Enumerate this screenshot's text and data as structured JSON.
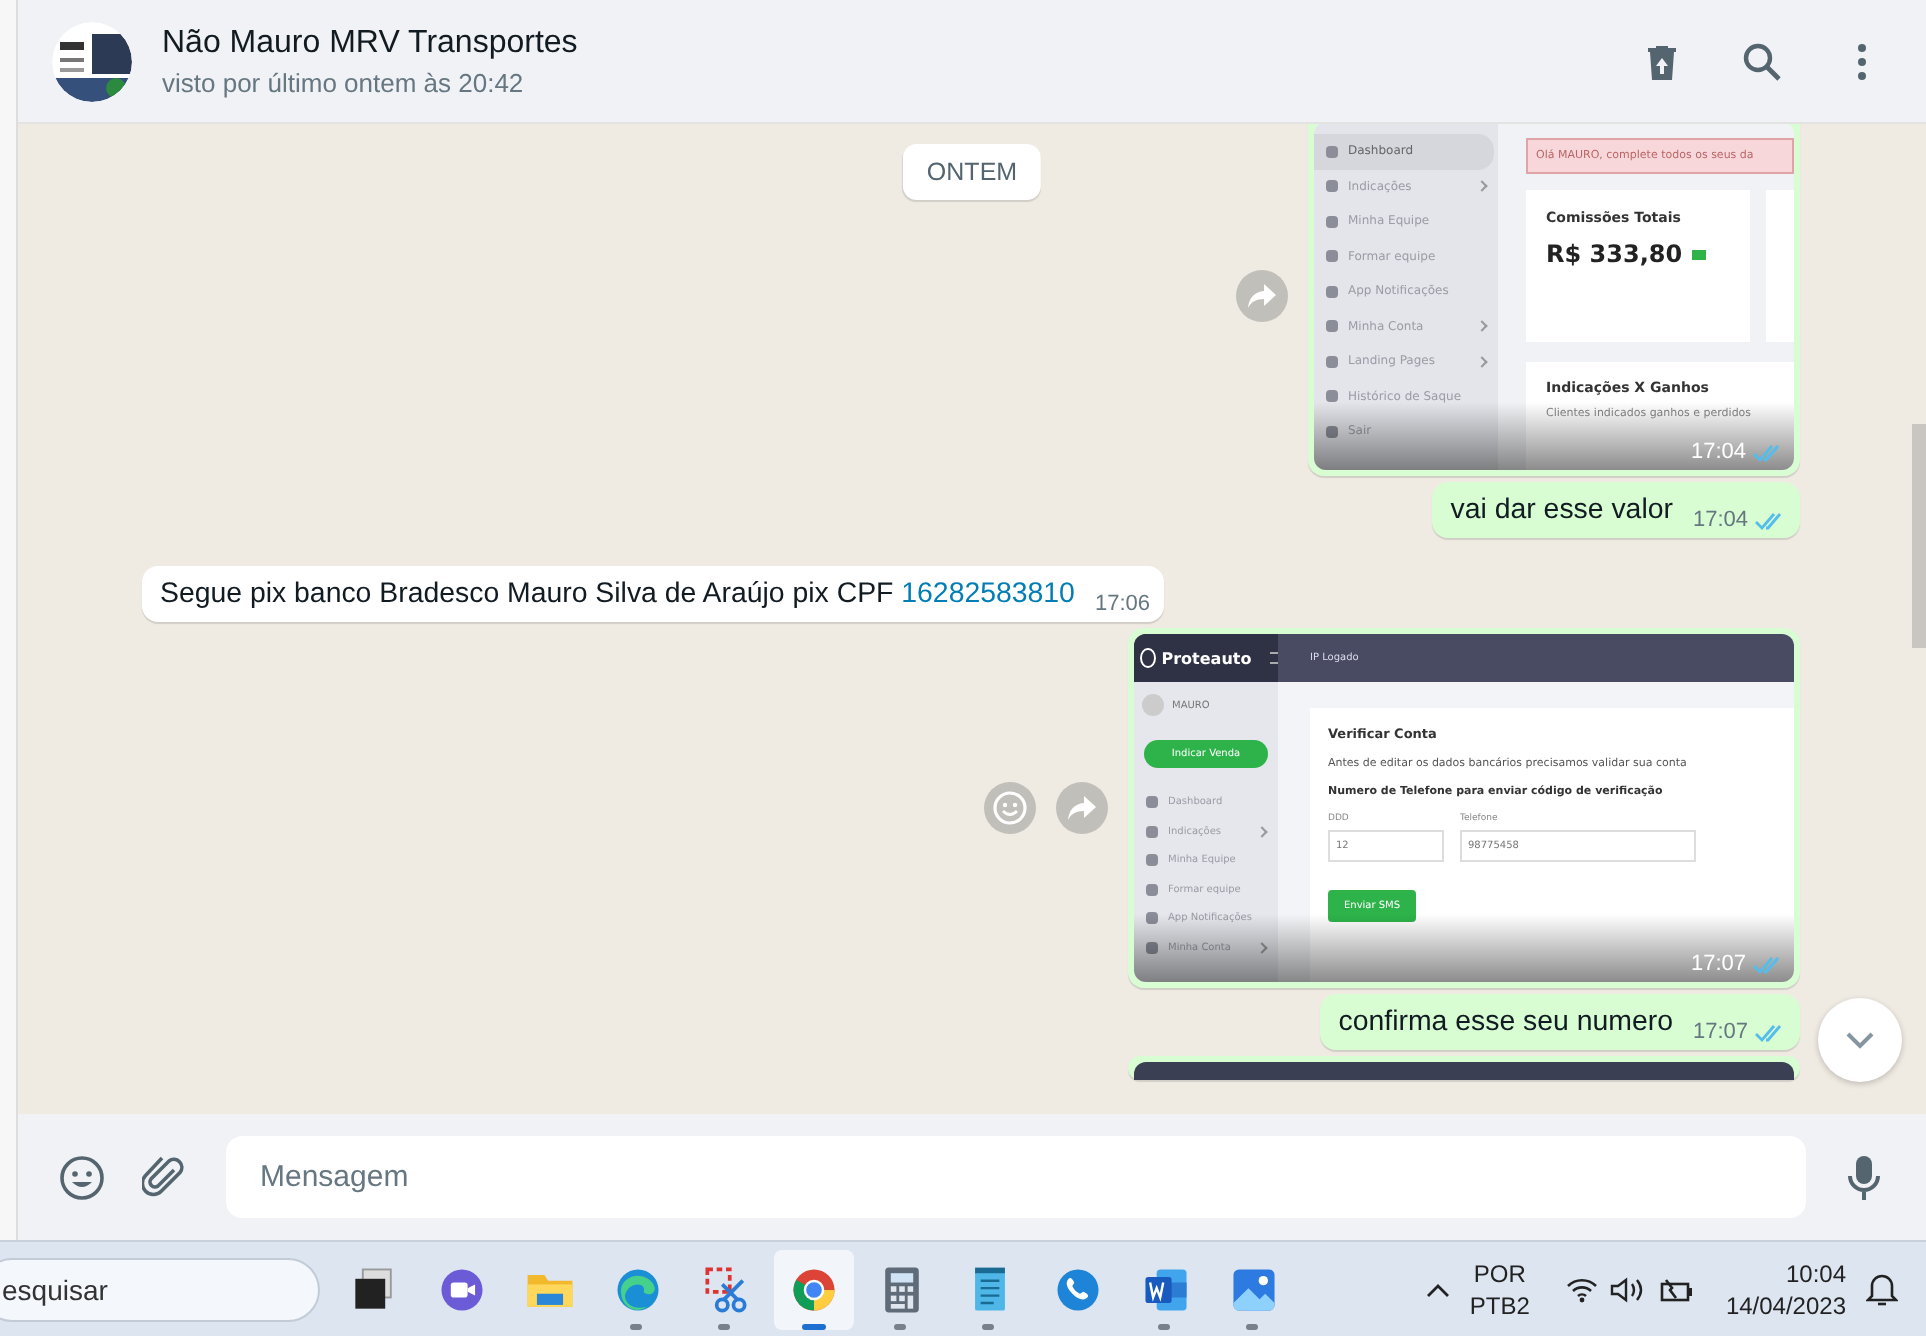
{
  "header": {
    "contact_name": "Não Mauro MRV Transportes",
    "last_seen": "visto por último ontem às 20:42"
  },
  "date_badge": "ONTEM",
  "messages": [
    {
      "kind": "image",
      "sent": true,
      "time": "17:04",
      "read": true,
      "forward_button": true,
      "screen": {
        "kind": "dashboard",
        "menu": [
          {
            "label": "Dashboard",
            "selected": true,
            "submenu": false
          },
          {
            "label": "Indicações",
            "selected": false,
            "submenu": true
          },
          {
            "label": "Minha Equipe",
            "selected": false,
            "submenu": false
          },
          {
            "label": "Formar equipe",
            "selected": false,
            "submenu": false
          },
          {
            "label": "App Notificações",
            "selected": false,
            "submenu": false
          },
          {
            "label": "Minha Conta",
            "selected": false,
            "submenu": true
          },
          {
            "label": "Landing Pages",
            "selected": false,
            "submenu": true
          },
          {
            "label": "Histórico de Saque",
            "selected": false,
            "submenu": false
          },
          {
            "label": "Sair",
            "selected": false,
            "submenu": false
          }
        ],
        "alert": "Olá MAURO, complete todos os seus da",
        "card_title": "Comissões Totais",
        "card_value": "R$ 333,80",
        "chart_title": "Indicações X Ganhos",
        "chart_subtitle": "Clientes indicados ganhos e perdidos"
      }
    },
    {
      "kind": "text",
      "sent": true,
      "text": "vai dar esse valor",
      "time": "17:04",
      "read": true
    },
    {
      "kind": "text",
      "sent": false,
      "text": "Segue pix banco Bradesco Mauro Silva de Araújo pix CPF",
      "link": "16282583810",
      "time": "17:06"
    },
    {
      "kind": "image",
      "sent": true,
      "time": "17:07",
      "read": true,
      "forward_button": true,
      "emoji_button": true,
      "screen": {
        "kind": "verify",
        "brand": "Proteauto",
        "ip": "IP Logado",
        "user": "MAURO",
        "action": "Indicar Venda",
        "menu": [
          {
            "label": "Dashboard",
            "selected": false,
            "submenu": false
          },
          {
            "label": "Indicações",
            "selected": false,
            "submenu": true
          },
          {
            "label": "Minha Equipe",
            "selected": false,
            "submenu": false
          },
          {
            "label": "Formar equipe",
            "selected": false,
            "submenu": false
          },
          {
            "label": "App Notificações",
            "selected": false,
            "submenu": false
          },
          {
            "label": "Minha Conta",
            "selected": false,
            "submenu": true
          }
        ],
        "title": "Verificar Conta",
        "intro": "Antes de editar os dados bancários precisamos validar sua conta",
        "subtitle": "Numero de Telefone para enviar código de verificação",
        "fields": [
          {
            "label": "DDD",
            "value": "12"
          },
          {
            "label": "Telefone",
            "value": "98775458"
          }
        ],
        "button": "Enviar SMS"
      }
    },
    {
      "kind": "text",
      "sent": true,
      "text": "confirma esse seu numero",
      "time": "17:07",
      "read": true
    },
    {
      "kind": "image",
      "sent": true
    }
  ],
  "composer": {
    "placeholder": "Mensagem"
  },
  "taskbar": {
    "search_placeholder": "esquisar",
    "apps": [
      {
        "kind": "taskview",
        "running": false,
        "selected": false
      },
      {
        "kind": "meet",
        "running": false,
        "selected": false
      },
      {
        "kind": "folder",
        "running": false,
        "selected": false
      },
      {
        "kind": "edge",
        "running": true,
        "selected": false
      },
      {
        "kind": "snip",
        "running": true,
        "selected": false
      },
      {
        "kind": "chrome",
        "running": true,
        "selected": true
      },
      {
        "kind": "calculator",
        "running": true,
        "selected": false
      },
      {
        "kind": "notepad",
        "running": true,
        "selected": false
      },
      {
        "kind": "phone",
        "running": false,
        "selected": false
      },
      {
        "kind": "word",
        "running": true,
        "selected": false
      },
      {
        "kind": "photos",
        "running": true,
        "selected": false
      }
    ],
    "language": "POR",
    "layout": "PTB2",
    "time": "10:04",
    "date": "14/04/2023"
  }
}
